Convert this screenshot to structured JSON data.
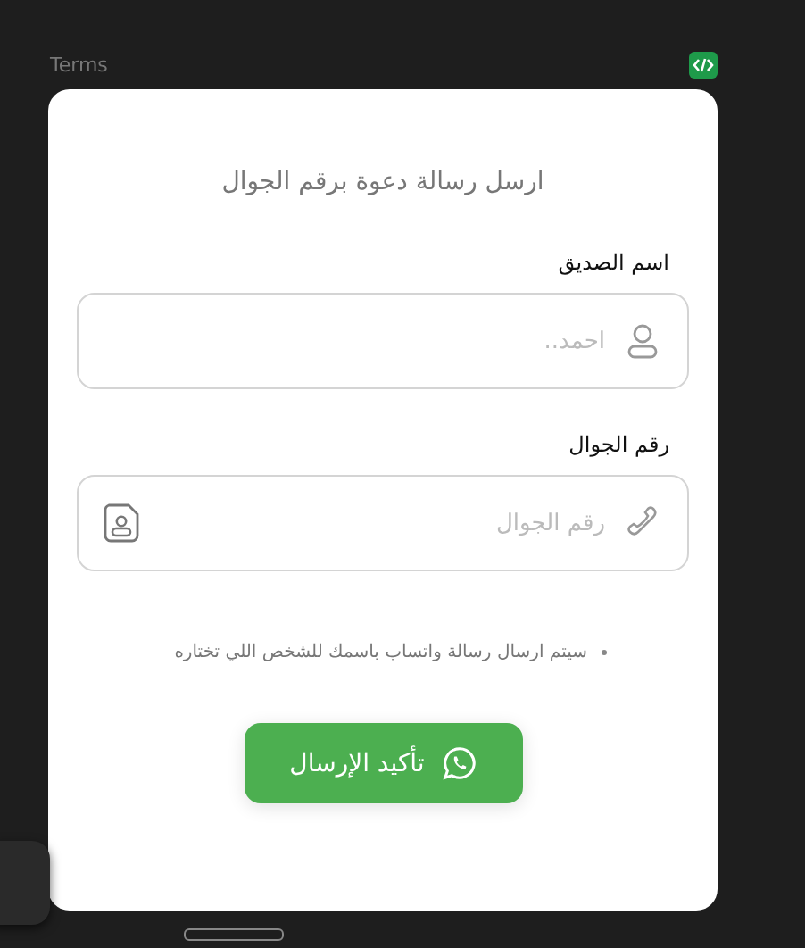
{
  "header": {
    "label": "Terms"
  },
  "form": {
    "title": "ارسل رسالة دعوة برقم الجوال",
    "fields": [
      {
        "kind": "name",
        "label": "اسم الصديق",
        "placeholder": "احمد.."
      },
      {
        "kind": "phone",
        "label": "رقم الجوال",
        "placeholder": "رقم الجوال"
      }
    ],
    "notes": [
      "سيتم ارسال رسالة واتساب باسمك للشخص اللي تختاره"
    ],
    "submit": {
      "label": "تأكيد الإرسال"
    }
  }
}
